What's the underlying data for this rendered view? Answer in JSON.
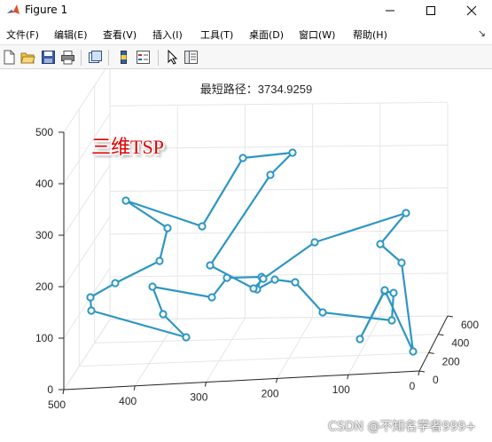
{
  "window": {
    "title": "Figure 1"
  },
  "menu": [
    "文件(F)",
    "编辑(E)",
    "查看(V)",
    "插入(I)",
    "工具(T)",
    "桌面(D)",
    "窗口(W)",
    "帮助(H)"
  ],
  "toolbar_icons": [
    "new-figure-icon",
    "open-icon",
    "save-icon",
    "print-icon",
    "link-plot-icon",
    "insert-colorbar-icon",
    "insert-legend-icon",
    "edit-plot-icon",
    "property-inspector-icon"
  ],
  "annotation": "三维TSP",
  "watermark": "CSDN @不知名学者999+",
  "colors": {
    "route": "#2e96c3",
    "annotation": "#e00000",
    "grid": "#e6e6e6",
    "axis": "#262626"
  },
  "chart_data": {
    "type": "line3d",
    "title": "最短路径：3734.9259",
    "x_ticks": [
      "500",
      "400",
      "300",
      "200",
      "100",
      "0"
    ],
    "y_ticks": [
      "0",
      "200",
      "400",
      "600"
    ],
    "z_ticks": [
      "0",
      "100",
      "200",
      "300",
      "400",
      "500"
    ],
    "xlim": [
      0,
      500
    ],
    "ylim": [
      0,
      600
    ],
    "zlim": [
      0,
      500
    ],
    "grid": true,
    "route_marker": "circle",
    "route": [
      [
        142,
        226
      ],
      [
        189,
        257
      ],
      [
        180,
        294
      ],
      [
        130,
        319
      ],
      [
        102,
        335
      ],
      [
        103,
        350
      ],
      [
        210,
        380
      ],
      [
        184,
        354
      ],
      [
        172,
        323
      ],
      [
        239,
        335
      ],
      [
        256,
        313
      ],
      [
        295,
        312
      ],
      [
        290,
        326
      ],
      [
        310,
        315
      ],
      [
        333,
        318
      ],
      [
        364,
        352
      ],
      [
        442,
        361
      ],
      [
        444,
        330
      ],
      [
        434,
        328
      ],
      [
        406,
        382
      ],
      [
        434,
        327
      ],
      [
        466,
        396
      ],
      [
        453,
        296
      ],
      [
        429,
        275
      ],
      [
        458,
        240
      ],
      [
        355,
        273
      ],
      [
        297,
        314
      ],
      [
        286,
        325
      ],
      [
        237,
        299
      ],
      [
        305,
        197
      ],
      [
        330,
        172
      ],
      [
        274,
        178
      ],
      [
        228,
        255
      ],
      [
        142,
        226
      ]
    ]
  }
}
